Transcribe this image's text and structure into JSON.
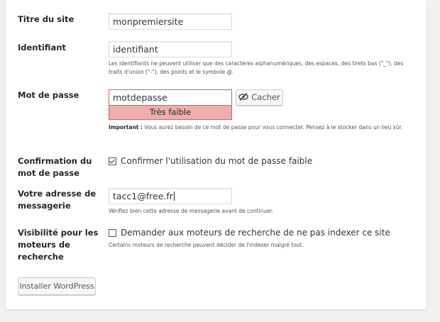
{
  "site_title": {
    "label": "Titre du site",
    "value": "monpremiersite"
  },
  "username": {
    "label": "Identifiant",
    "value": "identifiant",
    "help": "Les identifiants ne peuvent utiliser que des caractères alphanumériques, des espaces, des tirets bas (\"_\"), des traits d'union (\"-\"), des points et le symbole @."
  },
  "password": {
    "label": "Mot de passe",
    "value": "motdepasse",
    "hide_button_label": "Cacher",
    "strength_label": "Très faible",
    "important_prefix": "Important :",
    "important_text": " Vous aurez besoin de ce mot de passe pour vous connecter. Pensez à le stocker dans un lieu sûr."
  },
  "weak_password": {
    "label": "Confirmation du mot de passe",
    "checkbox_label": "Confirmer l'utilisation du mot de passe faible",
    "checked": true
  },
  "email": {
    "label": "Votre adresse de messagerie",
    "value": "tacc1@free.fr",
    "help": "Vérifiez bien cette adresse de messagerie avant de continuer."
  },
  "search_visibility": {
    "label": "Visibilité pour les moteurs de recherche",
    "checkbox_label": "Demander aux moteurs de recherche de ne pas indexer ce site",
    "checked": false,
    "help": "Certains moteurs de recherche peuvent décider de l'indexer malgré tout."
  },
  "submit": {
    "label": "Installer WordPress"
  },
  "colors": {
    "weak_strength_bg": "#f1adad",
    "weak_strength_border": "#e35b5b"
  },
  "icons": {
    "hide_password": "eye-slash-icon"
  }
}
